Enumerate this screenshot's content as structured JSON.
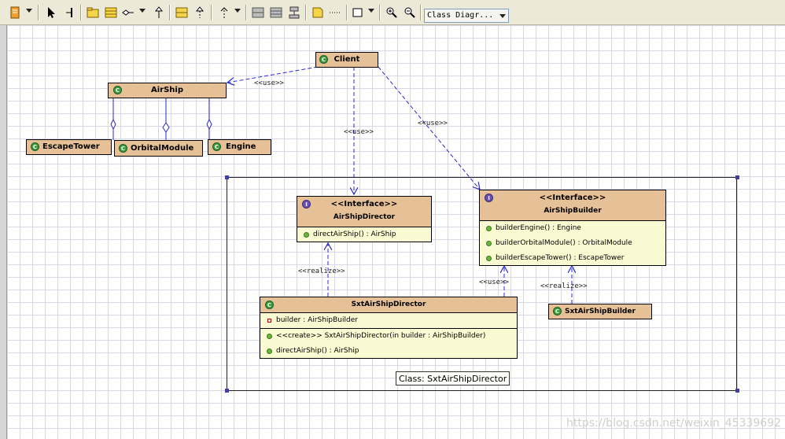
{
  "toolbar": {
    "buttons": [
      "document-icon",
      "pointer-icon",
      "anchor-icon",
      "folder-icon",
      "class-icon",
      "association-icon",
      "generalization-icon",
      "interface-icon",
      "realization-icon",
      "dependency-icon",
      "layout-horizontal-icon",
      "layout-vertical-icon",
      "layout-tree-icon",
      "note-icon",
      "note-link-icon",
      "rectangle-icon",
      "zoom-in-icon",
      "zoom-out-icon"
    ],
    "diagram_type": "Class Diagr..."
  },
  "classes": {
    "client": {
      "name": "Client"
    },
    "airship": {
      "name": "AirShip"
    },
    "escape_tower": {
      "name": "EscapeTower"
    },
    "orbital_module": {
      "name": "OrbitalModule"
    },
    "engine": {
      "name": "Engine"
    },
    "director_interface": {
      "stereotype": "<<Interface>>",
      "name": "AirShipDirector",
      "methods": [
        "directAirShip() : AirShip"
      ]
    },
    "builder_interface": {
      "stereotype": "<<Interface>>",
      "name": "AirShipBuilder",
      "methods": [
        "builderEngine() : Engine",
        "builderOrbitalModule() : OrbitalModule",
        "builderEscapeTower() : EscapeTower"
      ]
    },
    "sxt_director": {
      "name": "SxtAirShipDirector",
      "attributes": [
        "builder : AirShipBuilder"
      ],
      "methods": [
        "<<create>> SxtAirShipDirector(in builder : AirShipBuilder)",
        "directAirShip() : AirShip"
      ]
    },
    "sxt_builder": {
      "name": "SxtAirShipBuilder"
    }
  },
  "edge_labels": {
    "use1": "<<use>>",
    "use2": "<<use>>",
    "use3": "<<use>>",
    "use4": "<<use>>",
    "realize1": "<<realize>>",
    "realize2": "<<realize>>"
  },
  "frame_caption": "Class: SxtAirShipDirector",
  "watermark": "https://blog.csdn.net/weixin_45339692",
  "colors": {
    "class_header": "#e6c096",
    "class_body": "#fafad2",
    "edge": "#2a2ad0",
    "class_icon": "#3d9c3d",
    "interface_icon": "#6a4fb3"
  }
}
